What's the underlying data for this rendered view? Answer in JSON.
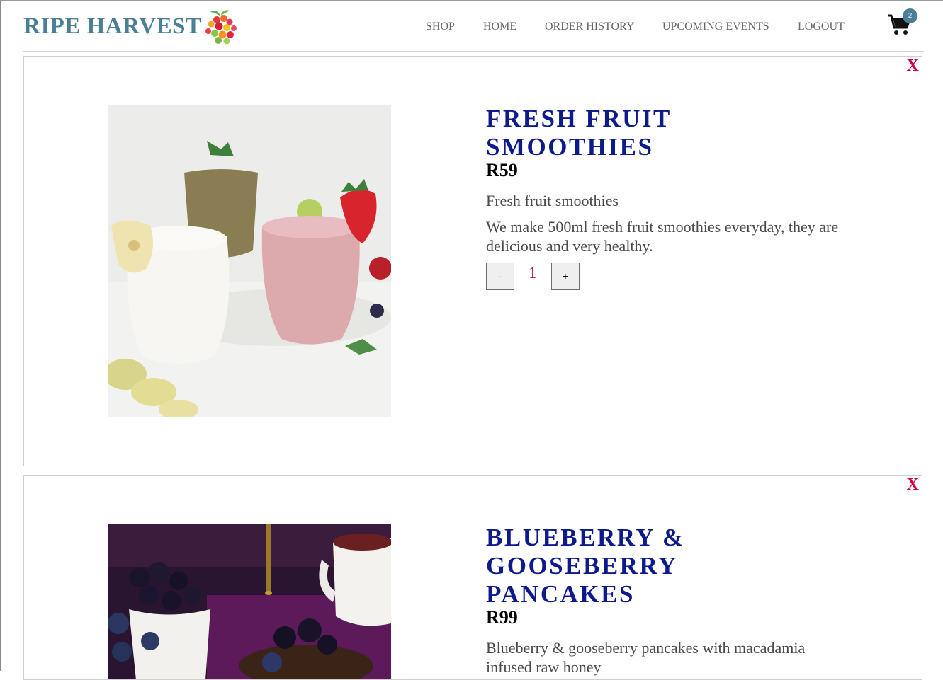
{
  "brand": {
    "name": "RIPE HARVEST"
  },
  "nav": {
    "items": [
      {
        "label": "SHOP"
      },
      {
        "label": "HOME"
      },
      {
        "label": "ORDER HISTORY"
      },
      {
        "label": "UPCOMING EVENTS"
      },
      {
        "label": "LOGOUT"
      }
    ],
    "cart_count": "2"
  },
  "items": [
    {
      "title_lines": [
        "FRESH FRUIT",
        "SMOOTHIES"
      ],
      "price": "R59",
      "short_desc": "Fresh fruit smoothies",
      "long_desc": "We make 500ml fresh fruit smoothies everyday, they are delicious and very healthy.",
      "quantity": "1",
      "minus_label": "-",
      "plus_label": "+",
      "remove_label": "X"
    },
    {
      "title_lines": [
        "BLUEBERRY &",
        "GOOSEBERRY",
        "PANCAKES"
      ],
      "price": "R99",
      "short_desc": "Blueberry & gooseberry pancakes with macadamia infused raw honey",
      "remove_label": "X"
    }
  ],
  "colors": {
    "brand": "#4a7f96",
    "title": "#0c1a8c",
    "remove": "#d2003c",
    "quantity": "#b0103a"
  }
}
